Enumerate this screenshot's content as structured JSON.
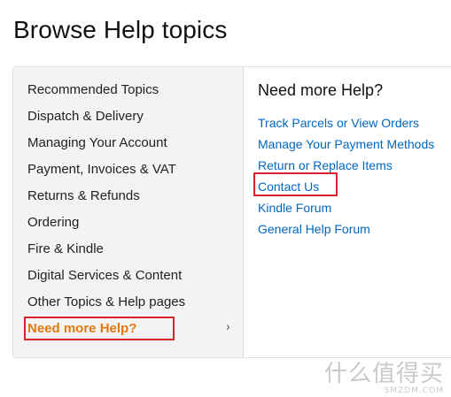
{
  "page": {
    "title": "Browse Help topics"
  },
  "left_nav": {
    "items": [
      {
        "label": "Recommended Topics"
      },
      {
        "label": "Dispatch & Delivery"
      },
      {
        "label": "Managing Your Account"
      },
      {
        "label": "Payment, Invoices & VAT"
      },
      {
        "label": "Returns & Refunds"
      },
      {
        "label": "Ordering"
      },
      {
        "label": "Fire & Kindle"
      },
      {
        "label": "Digital Services & Content"
      },
      {
        "label": "Other Topics & Help pages"
      },
      {
        "label": "Need more Help?",
        "active": true
      }
    ],
    "active_color": "#e47911",
    "chevron_icon": "chevron-right-icon"
  },
  "right_panel": {
    "heading": "Need more Help?",
    "links": [
      {
        "label": "Track Parcels or View Orders"
      },
      {
        "label": "Manage Your Payment Methods"
      },
      {
        "label": "Return or Replace Items"
      },
      {
        "label": "Contact Us"
      },
      {
        "label": "Kindle Forum"
      },
      {
        "label": "General Help Forum"
      }
    ],
    "link_color": "#0066c0"
  },
  "annotations": {
    "highlight_color": "#d9232d"
  },
  "watermark": {
    "main": "什么值得买",
    "sub": "SMZDM.COM"
  }
}
